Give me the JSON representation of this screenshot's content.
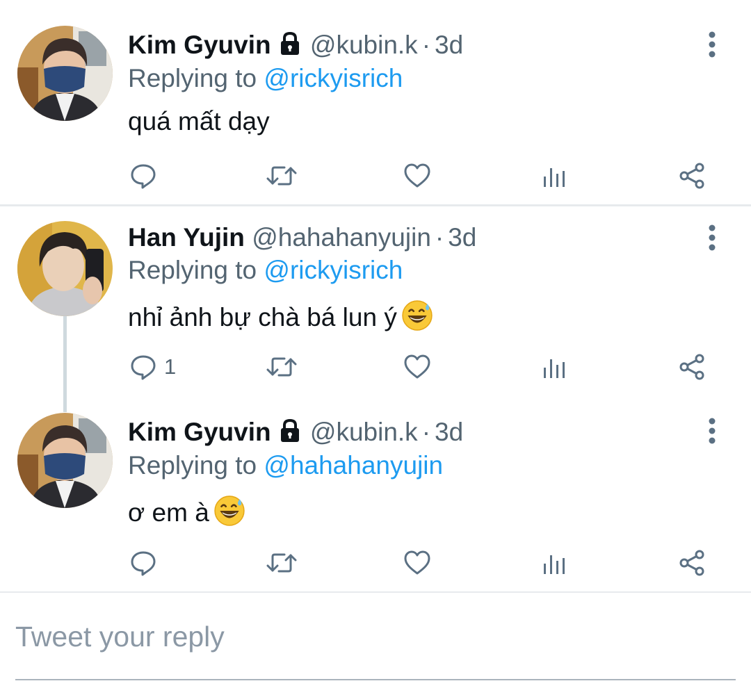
{
  "tweets": [
    {
      "name": "Kim Gyuvin",
      "protected": true,
      "handle": "@kubin.k",
      "time": "3d",
      "replying_prefix": "Replying to",
      "replying_to": "@rickyisrich",
      "text": "quá mất dạy",
      "emoji": "",
      "reply_count": "",
      "avatar": "avatar-gyuvin"
    },
    {
      "name": "Han Yujin",
      "protected": false,
      "handle": "@hahahanyujin",
      "time": "3d",
      "replying_prefix": "Replying to",
      "replying_to": "@rickyisrich",
      "text": "nhỉ ảnh bự chà bá lun ý",
      "emoji": "grinning-sweat-emoji",
      "reply_count": "1",
      "avatar": "avatar-yujin"
    },
    {
      "name": "Kim Gyuvin",
      "protected": true,
      "handle": "@kubin.k",
      "time": "3d",
      "replying_prefix": "Replying to",
      "replying_to": "@hahahanyujin",
      "text": "ơ em à",
      "emoji": "grinning-sweat-emoji",
      "reply_count": "",
      "avatar": "avatar-gyuvin"
    }
  ],
  "separator": "·",
  "compose": {
    "placeholder": "Tweet your reply"
  },
  "colors": {
    "text": "#0f1419",
    "secondary": "#536471",
    "link": "#1d9bf0",
    "icon": "#5b7083",
    "divider": "#e7eaed"
  },
  "icons": [
    "reply-icon",
    "retweet-icon",
    "like-icon",
    "views-icon",
    "share-icon",
    "more-icon",
    "lock-icon"
  ]
}
